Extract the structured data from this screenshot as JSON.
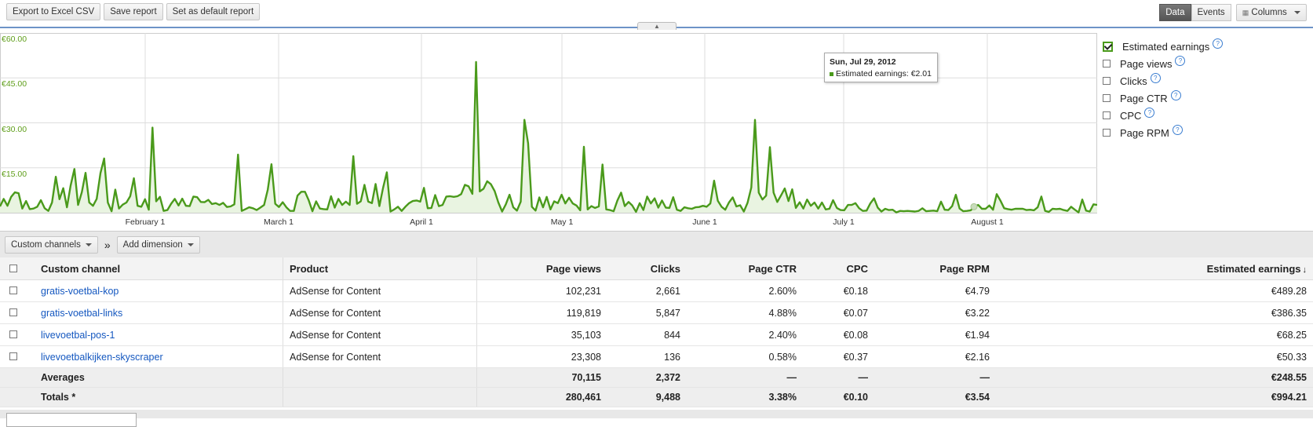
{
  "toolbar": {
    "export_label": "Export to Excel CSV",
    "save_label": "Save report",
    "default_label": "Set as default report",
    "data_label": "Data",
    "events_label": "Events",
    "columns_label": "Columns"
  },
  "chart_data": {
    "type": "line",
    "series": [
      {
        "name": "Estimated earnings",
        "values": [
          2.1,
          4.6,
          2.3,
          5.3,
          6.8,
          6.5,
          1.4,
          3.9,
          1.2,
          1.4,
          2.0,
          4.2,
          1.5,
          0.6,
          3.4,
          12.0,
          4.5,
          8.2,
          1.8,
          9.1,
          14.6,
          2.6,
          6.9,
          13.3,
          3.4,
          2.3,
          4.6,
          13.2,
          18.1,
          3.4,
          0.5,
          7.7,
          1.4,
          2.7,
          3.4,
          5.5,
          11.5,
          2.3,
          2.0,
          4.5,
          1.0,
          28.4,
          3.8,
          5.3,
          0.6,
          0.9,
          3.0,
          4.6,
          2.4,
          4.7,
          2.3,
          2.2,
          5.4,
          5.2,
          3.6,
          3.5,
          4.3,
          2.9,
          3.2,
          2.6,
          3.3,
          1.9,
          2.1,
          2.8,
          19.4,
          0.6,
          1.2,
          1.8,
          1.5,
          0.9,
          1.7,
          2.6,
          7.7,
          16.2,
          3.0,
          1.9,
          3.5,
          1.8,
          0.6,
          0.6,
          5.7,
          7.0,
          7.0,
          4.2,
          0.5,
          3.8,
          1.4,
          1.2,
          1.1,
          5.5,
          1.7,
          4.6,
          2.6,
          3.7,
          2.6,
          18.9,
          3.0,
          3.8,
          9.3,
          3.7,
          3.2,
          9.6,
          2.2,
          8.3,
          13.5,
          0.4,
          1.1,
          2.0,
          0.6,
          2.0,
          3.2,
          3.9,
          4.1,
          3.7,
          8.3,
          1.5,
          1.6,
          5.9,
          2.2,
          2.6,
          5.4,
          5.5,
          5.3,
          5.5,
          6.2,
          9.3,
          8.8,
          6.3,
          50.3,
          7.1,
          8.0,
          10.5,
          9.5,
          7.2,
          3.4,
          0.4,
          2.8,
          6.0,
          1.8,
          0.7,
          3.7,
          31.0,
          23.2,
          2.0,
          0.7,
          5.1,
          1.8,
          5.3,
          1.1,
          3.8,
          3.2,
          6.0,
          3.1,
          5.0,
          3.1,
          2.4,
          0.8,
          22.0,
          1.1,
          2.2,
          1.6,
          2.1,
          16.1,
          1.1,
          0.9,
          0.5,
          4.1,
          6.7,
          2.2,
          3.6,
          2.4,
          0.3,
          3.2,
          0.9,
          5.4,
          3.1,
          4.8,
          1.7,
          4.1,
          1.7,
          1.6,
          5.2,
          1.0,
          0.6,
          1.8,
          1.5,
          1.3,
          1.8,
          1.9,
          2.3,
          2.0,
          3.1,
          10.7,
          4.0,
          2.0,
          1.0,
          3.4,
          5.1,
          2.1,
          2.5,
          0.4,
          3.3,
          8.4,
          31.0,
          6.7,
          4.4,
          5.7,
          21.9,
          6.7,
          3.6,
          5.8,
          8.1,
          3.9,
          7.8,
          1.6,
          3.5,
          1.4,
          4.4,
          2.3,
          3.4,
          1.4,
          3.4,
          1.1,
          1.3,
          4.2,
          1.6,
          0.9,
          0.8,
          2.6,
          2.6,
          3.2,
          1.5,
          0.6,
          0.7,
          3.1,
          4.8,
          1.7,
          0.4,
          1.3,
          0.9,
          1.0,
          0.1,
          0.6,
          0.5,
          0.6,
          0.5,
          0.4,
          0.6,
          1.5,
          0.5,
          0.6,
          0.7,
          0.5,
          3.7,
          1.0,
          0.9,
          2.2,
          6.0,
          1.4,
          0.5,
          0.6,
          0.8,
          2.0,
          2.6,
          1.3,
          1.3,
          2.4,
          1.0,
          6.2,
          4.0,
          1.5,
          1.2,
          1.0,
          1.3,
          1.3,
          1.3,
          0.9,
          1.0,
          0.8,
          1.8,
          5.4,
          0.6,
          0.3,
          1.3,
          1.2,
          1.3,
          0.9,
          0.6,
          2.0,
          1.0,
          0.1,
          4.4,
          0.7,
          0.4,
          2.8,
          2.6
        ]
      }
    ],
    "x_tick_labels": [
      "February 1",
      "March 1",
      "April 1",
      "May 1",
      "June 1",
      "July 1",
      "August 1"
    ],
    "y_tick_labels": [
      "€60.00",
      "€45.00",
      "€30.00",
      "€15.00"
    ],
    "ylim": [
      0,
      60
    ],
    "grid": true,
    "tooltip": {
      "date": "Sun, Jul 29, 2012",
      "text": "Estimated earnings: €2.01"
    }
  },
  "metrics": [
    {
      "label": "Estimated earnings",
      "checked": true
    },
    {
      "label": "Page views",
      "checked": false
    },
    {
      "label": "Clicks",
      "checked": false
    },
    {
      "label": "Page CTR",
      "checked": false
    },
    {
      "label": "CPC",
      "checked": false
    },
    {
      "label": "Page RPM",
      "checked": false
    }
  ],
  "help_glyph": "?",
  "dimension": {
    "selector_label": "Custom channels",
    "separator": "»",
    "add_label": "Add dimension"
  },
  "table": {
    "headers": [
      "Custom channel",
      "Product",
      "Page views",
      "Clicks",
      "Page CTR",
      "CPC",
      "Page RPM",
      "Estimated earnings"
    ],
    "sort_arrow": "↓",
    "rows": [
      [
        "gratis-voetbal-kop",
        "AdSense for Content",
        "102,231",
        "2,661",
        "2.60%",
        "€0.18",
        "€4.79",
        "€489.28"
      ],
      [
        "gratis-voetbal-links",
        "AdSense for Content",
        "119,819",
        "5,847",
        "4.88%",
        "€0.07",
        "€3.22",
        "€386.35"
      ],
      [
        "livevoetbal-pos-1",
        "AdSense for Content",
        "35,103",
        "844",
        "2.40%",
        "€0.08",
        "€1.94",
        "€68.25"
      ],
      [
        "livevoetbalkijken-skyscraper",
        "AdSense for Content",
        "23,308",
        "136",
        "0.58%",
        "€0.37",
        "€2.16",
        "€50.33"
      ]
    ],
    "averages": [
      "Averages",
      "",
      "70,115",
      "2,372",
      "—",
      "—",
      "—",
      "€248.55"
    ],
    "totals": [
      "Totals *",
      "",
      "280,461",
      "9,488",
      "3.38%",
      "€0.10",
      "€3.54",
      "€994.21"
    ]
  }
}
